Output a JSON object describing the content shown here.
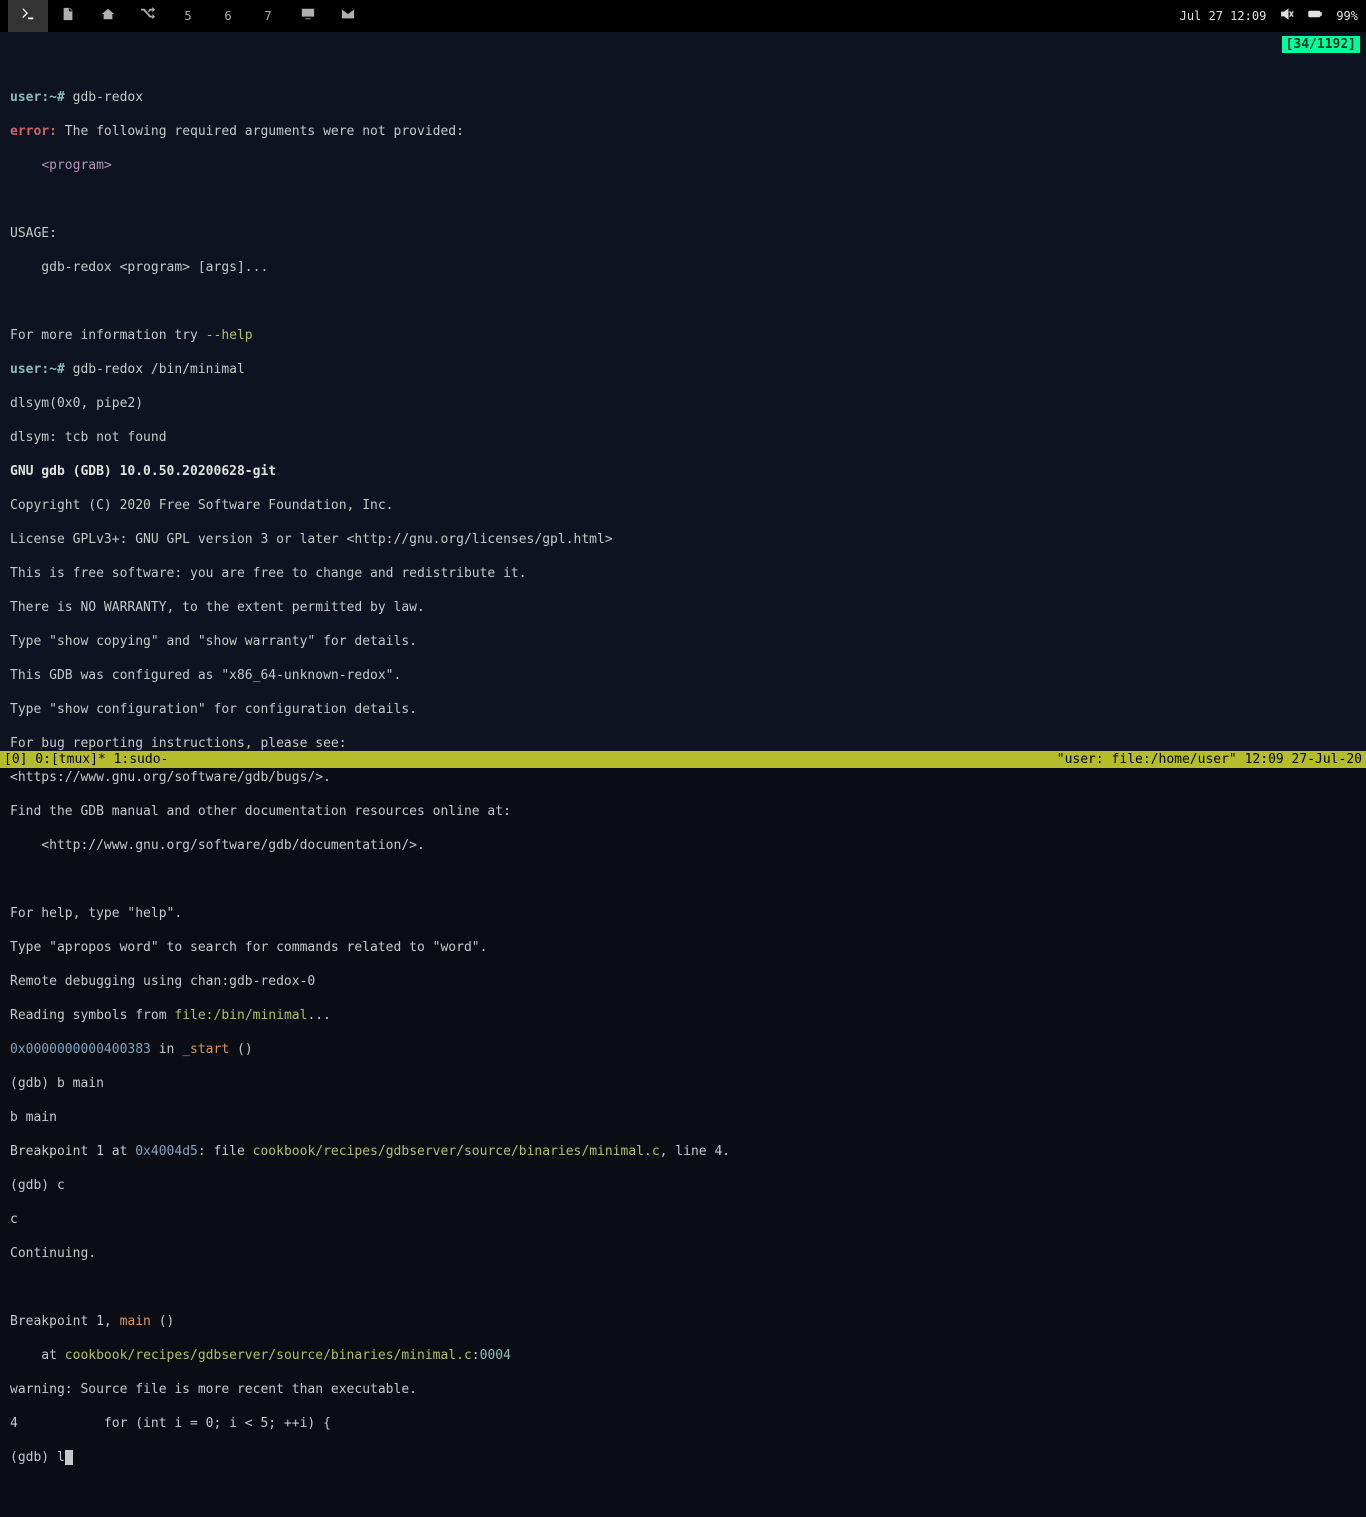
{
  "topbar": {
    "items": [
      {
        "type": "icon",
        "name": "terminal-icon",
        "active": true
      },
      {
        "type": "icon",
        "name": "document-icon"
      },
      {
        "type": "icon",
        "name": "home-icon"
      },
      {
        "type": "icon",
        "name": "shuffle-icon"
      },
      {
        "type": "text",
        "label": "5"
      },
      {
        "type": "text",
        "label": "6"
      },
      {
        "type": "text",
        "label": "7"
      },
      {
        "type": "icon",
        "name": "monitor-icon"
      },
      {
        "type": "icon",
        "name": "mail-icon"
      }
    ],
    "clock": "Jul 27 12:09",
    "volume_icon": "volume-mute-icon",
    "battery_icon": "battery-icon",
    "battery": "99%"
  },
  "scroll_indicator": "[34/1192]",
  "terminal": {
    "prompt_user": "user",
    "prompt_path": ":~#",
    "cmd1": "gdb-redox",
    "error_label": "error:",
    "error_msg": " The following required arguments were not provided:",
    "error_arg": "<program>",
    "usage_header": "USAGE:",
    "usage_line": "    gdb-redox <program> [args]...",
    "more_info_prefix": "For more information try ",
    "help_flag": "--help",
    "cmd2": "gdb-redox /bin/minimal",
    "dlsym1": "dlsym(0x0, pipe2)",
    "dlsym2": "dlsym: tcb not found",
    "gdb_version": "GNU gdb (GDB) 10.0.50.20200628-git",
    "copyright": "Copyright (C) 2020 Free Software Foundation, Inc.",
    "license": "License GPLv3+: GNU GPL version 3 or later <http://gnu.org/licenses/gpl.html>",
    "freesw1": "This is free software: you are free to change and redistribute it.",
    "freesw2": "There is NO WARRANTY, to the extent permitted by law.",
    "freesw3": "Type \"show copying\" and \"show warranty\" for details.",
    "config1": "This GDB was configured as \"x86_64-unknown-redox\".",
    "config2": "Type \"show configuration\" for configuration details.",
    "bugs1": "For bug reporting instructions, please see:",
    "bugs2": "<https://www.gnu.org/software/gdb/bugs/>.",
    "manual1": "Find the GDB manual and other documentation resources online at:",
    "manual2": "    <http://www.gnu.org/software/gdb/documentation/>.",
    "help1": "For help, type \"help\".",
    "help2": "Type \"apropos word\" to search for commands related to \"word\".",
    "remote": "Remote debugging using chan:gdb-redox-0",
    "reading_prefix": "Reading symbols from ",
    "reading_path": "file:/bin/minimal",
    "reading_suffix": "...",
    "addr_start": "0x0000000000400383",
    "in_text": " in ",
    "start_func": "_start",
    "after_func": " ()",
    "gdb_prompt": "(gdb) ",
    "bmain": "b main",
    "bmain_echo": "b main",
    "bp_prefix": "Breakpoint 1 at ",
    "bp_addr": "0x4004d5",
    "bp_file_prefix": ": file ",
    "bp_file": "cookbook/recipes/gdbserver/source/binaries/minimal.c",
    "bp_line": ", line 4.",
    "c_cmd": "c",
    "c_echo": "c",
    "continuing": "Continuing.",
    "bp_hit_prefix": "Breakpoint 1, ",
    "main_func": "main",
    "main_suffix": " ()",
    "at_prefix": "    at ",
    "at_file": "cookbook/recipes/gdbserver/source/binaries/minimal.c",
    "at_colon": ":",
    "at_line": "0004",
    "warning": "warning: Source file is more recent than executable.",
    "src_line_num": "4",
    "src_line": "           for (int i = 0; i < 5; ++i) {",
    "last_cmd": "l"
  },
  "tmux": {
    "left": "[0] 0:[tmux]* 1:sudo-",
    "right": "\"user: file:/home/user\" 12:09 27-Jul-20"
  }
}
